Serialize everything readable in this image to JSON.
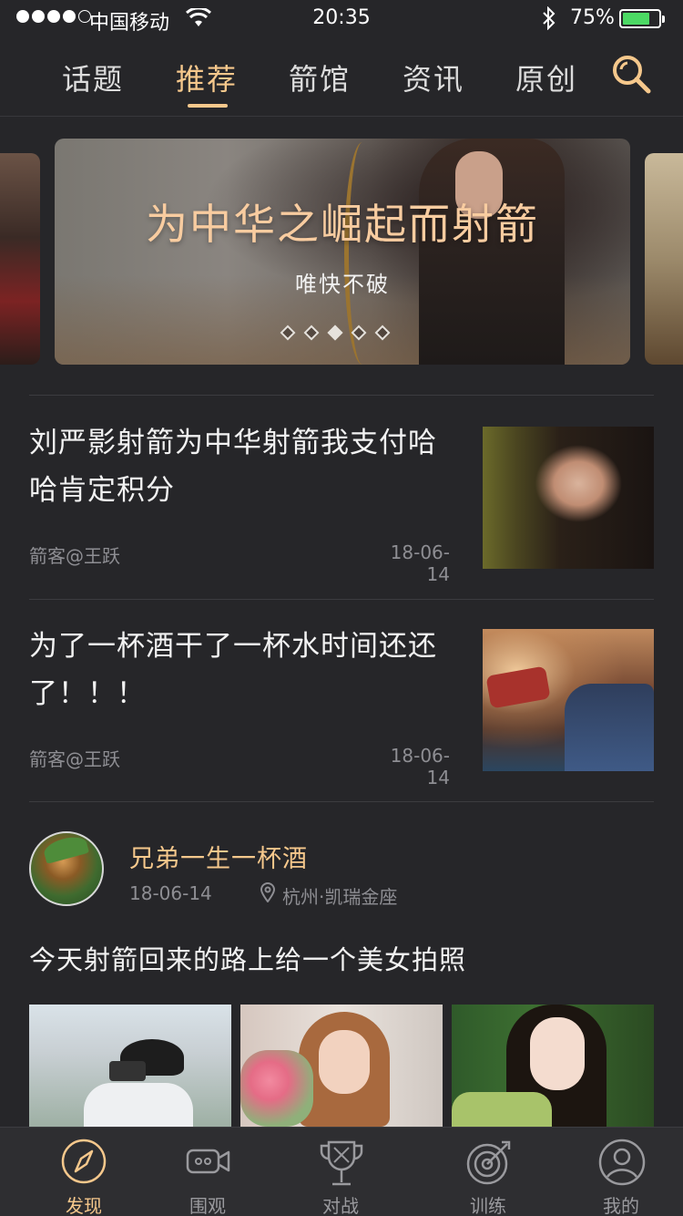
{
  "status_bar": {
    "carrier": "中国移动",
    "time": "20:35",
    "battery": "75%",
    "battery_level": 0.75
  },
  "top_tabs": {
    "items": [
      {
        "label": "话题",
        "active": false
      },
      {
        "label": "推荐",
        "active": true
      },
      {
        "label": "箭馆",
        "active": false
      },
      {
        "label": "资讯",
        "active": false
      },
      {
        "label": "原创",
        "active": false
      }
    ],
    "search_icon": "search-icon"
  },
  "banner": {
    "title": "为中华之崛起而射箭",
    "subtitle": "唯快不破",
    "page_count": 5,
    "current_page": 3
  },
  "articles": [
    {
      "title": "刘严影射箭为中华射箭我支付哈哈肯定积分",
      "author": "箭客@王跃",
      "date": "18-06-14"
    },
    {
      "title": "为了一杯酒干了一杯水时间还还了！！！",
      "author": "箭客@王跃",
      "date": "18-06-14"
    }
  ],
  "post": {
    "username": "兄弟一生一杯酒",
    "date": "18-06-14",
    "location": "杭州·凯瑞金座",
    "text": "今天射箭回来的路上给一个美女拍照",
    "photo_count": 3
  },
  "bottom_tabs": {
    "items": [
      {
        "label": "发现",
        "icon": "compass-icon",
        "active": true
      },
      {
        "label": "围观",
        "icon": "video-camera-icon",
        "active": false
      },
      {
        "label": "对战",
        "icon": "trophy-icon",
        "active": false
      },
      {
        "label": "训练",
        "icon": "target-icon",
        "active": false
      },
      {
        "label": "我的",
        "icon": "user-icon",
        "active": false
      }
    ]
  },
  "colors": {
    "background": "#262629",
    "accent": "#f6c88c",
    "muted_text": "#8e8e93",
    "tabbar_background": "#2e2e31"
  }
}
